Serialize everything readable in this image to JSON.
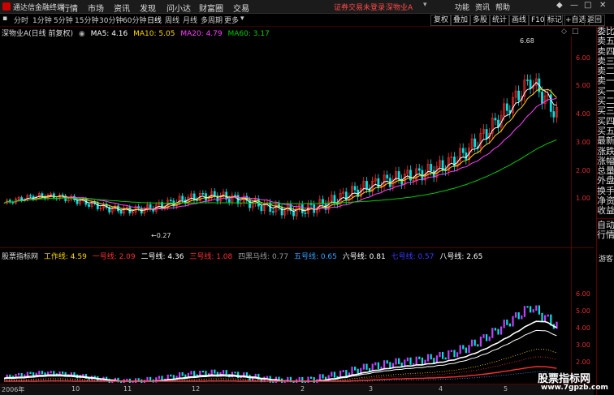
{
  "app": {
    "title": "通达信金融终端"
  },
  "menu": [
    "行情",
    "市场",
    "资讯",
    "发现",
    "问小达",
    "财富圈",
    "交易"
  ],
  "notice": "证券交易未登录",
  "stock_name": "深物业A",
  "right_menu": [
    "功能",
    "资讯",
    "帮助"
  ],
  "periods": [
    "分时",
    "1分钟",
    "5分钟",
    "15分钟",
    "30分钟",
    "60分钟",
    "日线",
    "周线",
    "月线",
    "多周期",
    "更多"
  ],
  "active_period": "日线",
  "tool_buttons": [
    "复权",
    "叠加",
    "多股",
    "统计",
    "画线",
    "F10",
    "标记",
    "+自选",
    "返回"
  ],
  "main_chart": {
    "title": "深物业A(日线 前复权)",
    "ma5_label": "MA5: 4.16",
    "ma10_label": "MA10: 5.05",
    "ma20_label": "MA20: 4.79",
    "ma60_label": "MA60: 3.17",
    "high_label": "6.68",
    "low_label": "←0.27",
    "y_ticks": [
      "6.00",
      "5.00",
      "4.00",
      "3.00",
      "2.00",
      "1.00"
    ]
  },
  "indicator": {
    "name": "股票指标网",
    "lines": [
      {
        "label": "工作线: 4.59",
        "color": "#ffd700"
      },
      {
        "label": "一号线: 2.09",
        "color": "#ff3030"
      },
      {
        "label": "二号线: 4.36",
        "color": "#ffffff"
      },
      {
        "label": "三号线: 1.08",
        "color": "#ff3030"
      },
      {
        "label": "四黑马线: 0.77",
        "color": "#888888"
      },
      {
        "label": "五号线: 0.65",
        "color": "#3aa0ff"
      },
      {
        "label": "六号线: 0.81",
        "color": "#ffffff"
      },
      {
        "label": "七号线: 0.57",
        "color": "#3a3aff"
      },
      {
        "label": "八号线: 2.65",
        "color": "#ffffff"
      }
    ],
    "y_ticks": [
      "6.00",
      "5.00",
      "4.00",
      "3.00",
      "2.00",
      "1.00"
    ]
  },
  "dates": [
    "2006年",
    "10",
    "11",
    "12",
    "2",
    "3",
    "4",
    "5"
  ],
  "right_panel": [
    "委比",
    "卖五",
    "卖四",
    "卖三",
    "卖二",
    "卖一",
    "买一",
    "买二",
    "买三",
    "买四",
    "买五",
    "最新",
    "涨跌",
    "涨幅",
    "总量",
    "外盘",
    "换手",
    "净资",
    "收益",
    "自动",
    "行情",
    "游客"
  ],
  "watermark": {
    "line1": "股票指标网",
    "line2": "www.7gpzb.com"
  },
  "colors": {
    "up": "#ff3030",
    "down": "#00e0e0",
    "ma5": "#ffffff",
    "ma10": "#ffd700",
    "ma20": "#ff40ff",
    "ma60": "#00cc00"
  }
}
